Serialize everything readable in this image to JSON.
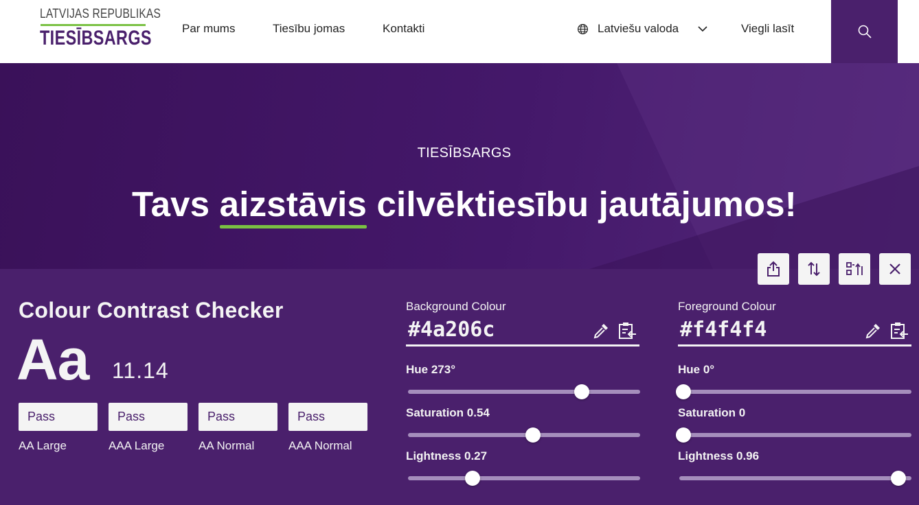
{
  "header": {
    "logo_top": "LATVIJAS REPUBLIKAS",
    "logo_main": "TIESĪBSARGS",
    "nav": [
      "Par mums",
      "Tiesību jomas",
      "Kontakti"
    ],
    "language": "Latviešu valoda",
    "easy_read": "Viegli lasīt",
    "icons": {
      "language": "globe-icon",
      "dropdown": "chevron-down-icon",
      "search": "search-icon"
    }
  },
  "hero": {
    "eyebrow": "TIESĪBSARGS",
    "title_before": "Tavs ",
    "title_highlight": "aizstāvis",
    "title_after": " cilvēktiesību jautājumos!"
  },
  "toolbar": {
    "icons": [
      "share-icon",
      "swap-icon",
      "layout-icon",
      "close-icon"
    ]
  },
  "checker": {
    "title": "Colour Contrast Checker",
    "sample": "Aa",
    "ratio": "11.14",
    "results": [
      {
        "value": "Pass",
        "label": "AA Large"
      },
      {
        "value": "Pass",
        "label": "AAA Large"
      },
      {
        "value": "Pass",
        "label": "AA Normal"
      },
      {
        "value": "Pass",
        "label": "AAA Normal"
      }
    ],
    "background": {
      "label": "Background Colour",
      "hex": "#4a206c",
      "hue_label": "Hue 273°",
      "hue_fraction": 0.758,
      "saturation_label": "Saturation 0.54",
      "saturation_fraction": 0.54,
      "lightness_label": "Lightness 0.27",
      "lightness_fraction": 0.27
    },
    "foreground": {
      "label": "Foreground Colour",
      "hex": "#f4f4f4",
      "hue_label": "Hue 0°",
      "hue_fraction": 0,
      "saturation_label": "Saturation 0",
      "saturation_fraction": 0,
      "lightness_label": "Lightness 0.96",
      "lightness_fraction": 0.96
    },
    "field_icons": [
      "eyedropper-icon",
      "paste-icon"
    ]
  },
  "colors": {
    "brand_purple": "#4a206c",
    "accent_green": "#7ac143",
    "foreground": "#f4f4f4"
  }
}
